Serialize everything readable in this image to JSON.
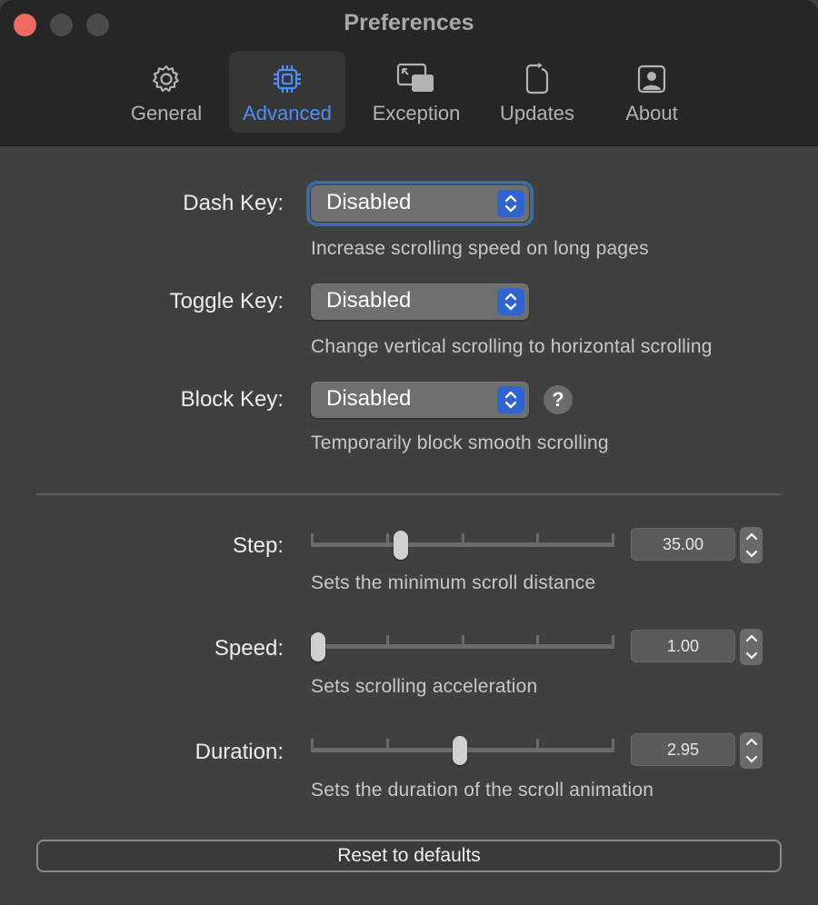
{
  "window": {
    "title": "Preferences"
  },
  "tabs": [
    {
      "label": "General",
      "icon": "gear-icon"
    },
    {
      "label": "Advanced",
      "icon": "cpu-chip-icon",
      "active": true
    },
    {
      "label": "Exception",
      "icon": "windows-icon"
    },
    {
      "label": "Updates",
      "icon": "refresh-phone-icon"
    },
    {
      "label": "About",
      "icon": "person-card-icon"
    }
  ],
  "keys": {
    "dash": {
      "label": "Dash Key:",
      "value": "Disabled",
      "description": "Increase scrolling speed on long pages"
    },
    "toggle": {
      "label": "Toggle Key:",
      "value": "Disabled",
      "description": "Change vertical scrolling to horizontal scrolling"
    },
    "block": {
      "label": "Block Key:",
      "value": "Disabled",
      "description": "Temporarily block smooth scrolling",
      "help": "?"
    }
  },
  "sliders": {
    "step": {
      "label": "Step:",
      "value": "35.00",
      "position": 0.285,
      "description": "Sets the minimum scroll distance"
    },
    "speed": {
      "label": "Speed:",
      "value": "1.00",
      "position": 0.0,
      "description": "Sets scrolling acceleration"
    },
    "duration": {
      "label": "Duration:",
      "value": "2.95",
      "position": 0.49,
      "description": "Sets the duration of the scroll animation"
    }
  },
  "reset_label": "Reset to defaults",
  "colors": {
    "accent": "#4f8df9",
    "select_arrows": "#2f63cf",
    "close": "#ed6a5e"
  }
}
